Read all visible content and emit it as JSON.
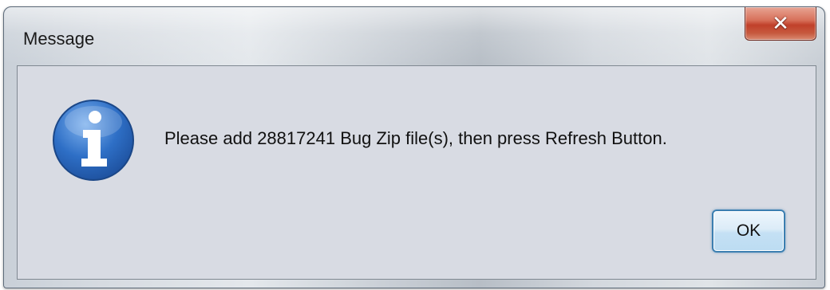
{
  "window": {
    "title": "Message",
    "close_icon": "close-icon"
  },
  "dialog": {
    "icon": "info-icon",
    "icon_color": "#2e6fc6",
    "message": "Please add 28817241 Bug Zip file(s), then press Refresh Button.",
    "ok_label": "OK"
  },
  "colors": {
    "content_bg": "#d8dbe3",
    "close_button": "#c9503a",
    "ok_border": "#3c7fb1"
  }
}
